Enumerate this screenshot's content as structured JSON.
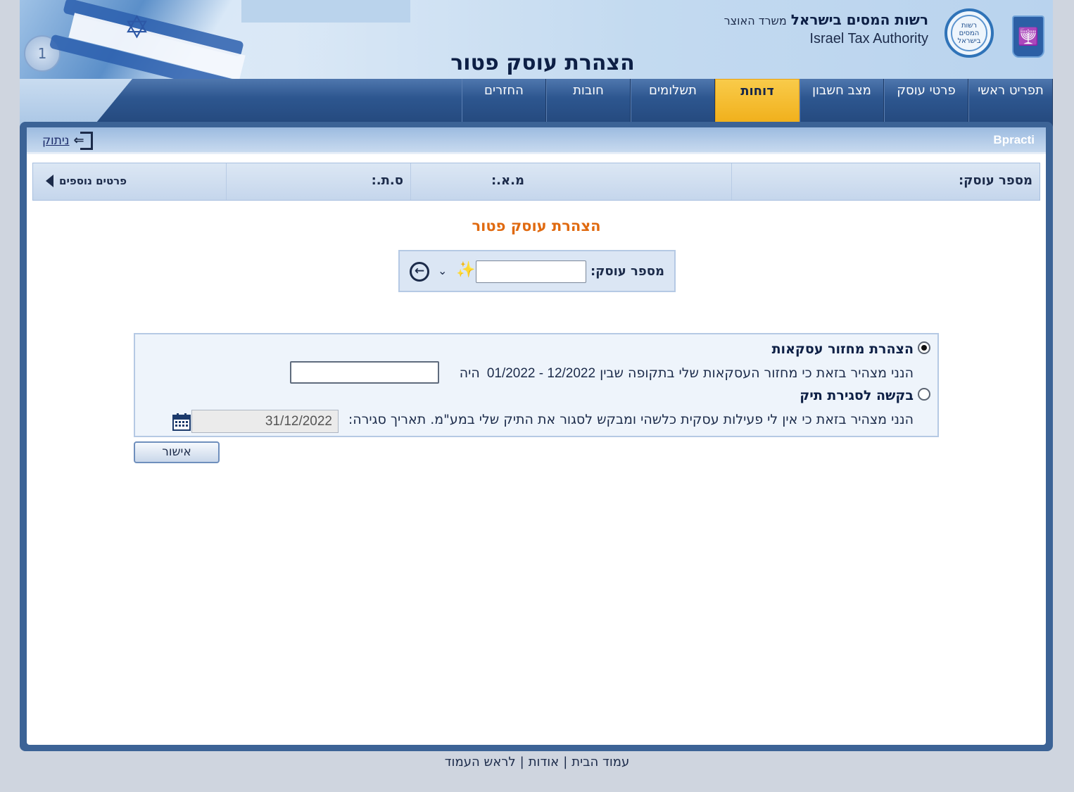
{
  "header": {
    "page_heading": "הצהרת עוסק פטור",
    "authority_name_he": "רשות המסים בישראל",
    "ministry_he": "משרד האוצר",
    "authority_name_en": "Israel Tax Authority",
    "logo_text": "רשות המסים בישראל"
  },
  "nav": {
    "tabs": [
      {
        "label": "תפריט ראשי",
        "active": false
      },
      {
        "label": "פרטי עוסק",
        "active": false
      },
      {
        "label": "מצב חשבון",
        "active": false
      },
      {
        "label": "דוחות",
        "active": true
      },
      {
        "label": "תשלומים",
        "active": false
      },
      {
        "label": "חובות",
        "active": false
      },
      {
        "label": "החזרים",
        "active": false
      }
    ]
  },
  "user_bar": {
    "username": "Bpracti",
    "logout_label": "ניתוק"
  },
  "info_bar": {
    "dealer_number_label": "מספר עוסק:",
    "ma_label": "מ.א.:",
    "st_label": "ס.ת.:",
    "more_details_label": "פרטים נוספים"
  },
  "form": {
    "title": "הצהרת עוסק פטור",
    "search_label": "מספר עוסק:",
    "search_value": "",
    "option_turnover": {
      "label": "הצהרת מחזור עסקאות",
      "selected": true,
      "text_prefix": "הנני מצהיר בזאת כי מחזור העסקאות שלי בתקופה שבין",
      "period": "12/2022 - 01/2022",
      "text_suffix": "היה",
      "amount_value": ""
    },
    "option_close": {
      "label": "בקשה לסגירת תיק",
      "selected": false,
      "text": "הנני מצהיר בזאת כי אין לי פעילות עסקית כלשהי ומבקש לסגור את התיק שלי במע\"מ. תאריך סגירה:",
      "closing_date": "31/12/2022"
    },
    "approve_label": "אישור"
  },
  "footer": {
    "links": [
      "עמוד הבית",
      "אודות",
      "לראש העמוד"
    ]
  },
  "colors": {
    "nav_blue": "#2d568f",
    "active_tab": "#f0ae18",
    "form_title": "#e06a10"
  }
}
